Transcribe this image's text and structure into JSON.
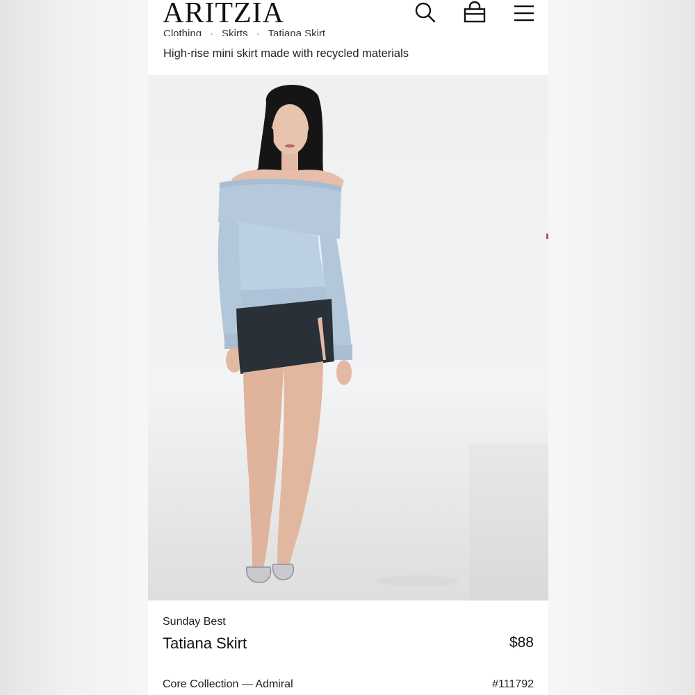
{
  "header": {
    "logo": "ARITZIA",
    "icons": [
      "search-icon",
      "shopping-bag-icon",
      "menu-icon"
    ]
  },
  "breadcrumb": [
    "Clothing",
    "Skirts",
    "Tatiana Skirt"
  ],
  "subtitle": "High-rise mini skirt made with recycled materials",
  "product": {
    "collection": "Sunday Best",
    "name": "Tatiana Skirt",
    "price": "$88",
    "variant": "Core Collection — Admiral",
    "sku": "#111792"
  },
  "colors": {
    "sweater": "#b9cde0",
    "skirt": "#2a3038",
    "text": "#111111"
  }
}
